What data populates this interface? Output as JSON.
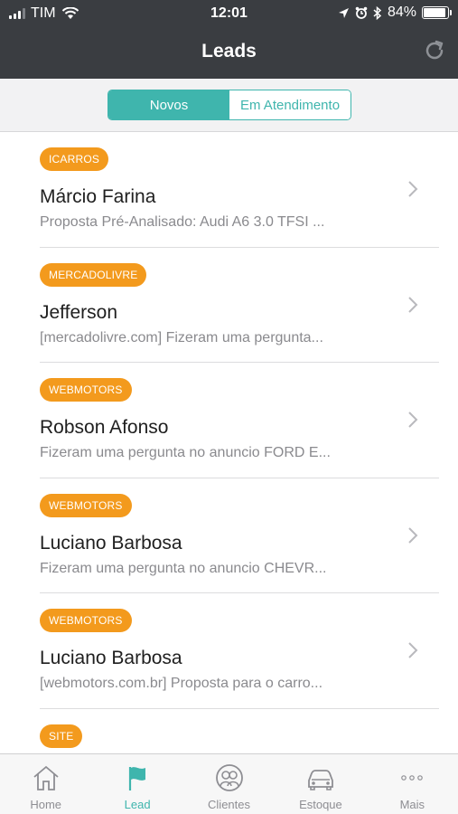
{
  "status_bar": {
    "carrier": "TIM",
    "time": "12:01",
    "battery": "84%",
    "battery_level": 0.84
  },
  "header": {
    "title": "Leads"
  },
  "segments": [
    {
      "label": "Novos",
      "active": true
    },
    {
      "label": "Em Atendimento",
      "active": false
    }
  ],
  "leads": [
    {
      "source": "ICARROS",
      "name": "Márcio Farina",
      "preview": "Proposta Pré-Analisado: Audi A6 3.0 TFSI ..."
    },
    {
      "source": "MERCADOLIVRE",
      "name": "Jefferson",
      "preview": "[mercadolivre.com] Fizeram uma pergunta..."
    },
    {
      "source": "WEBMOTORS",
      "name": "Robson Afonso",
      "preview": "Fizeram uma pergunta no anuncio FORD E..."
    },
    {
      "source": "WEBMOTORS",
      "name": "Luciano Barbosa",
      "preview": "Fizeram uma pergunta no anuncio CHEVR..."
    },
    {
      "source": "WEBMOTORS",
      "name": "Luciano Barbosa",
      "preview": "[webmotors.com.br] Proposta para o carro..."
    },
    {
      "source": "SITE",
      "name": "",
      "preview": ""
    }
  ],
  "tabbar": {
    "items": [
      {
        "label": "Home",
        "icon": "home-icon"
      },
      {
        "label": "Lead",
        "icon": "flag-icon",
        "active": true
      },
      {
        "label": "Clientes",
        "icon": "clients-icon"
      },
      {
        "label": "Estoque",
        "icon": "car-icon"
      },
      {
        "label": "Mais",
        "icon": "more-icon"
      }
    ]
  },
  "colors": {
    "accent": "#3fb5ad",
    "badge": "#f39a1d",
    "header": "#3a3d41"
  }
}
